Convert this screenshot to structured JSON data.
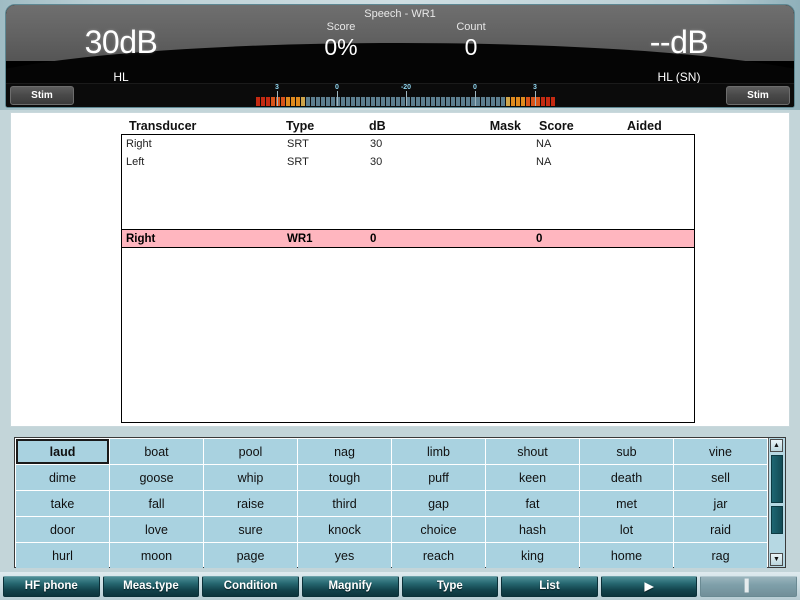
{
  "header": {
    "title": "Speech - WR1",
    "left_readout": {
      "value": "30dB",
      "unit": "HL"
    },
    "right_readout": {
      "value": "--dB",
      "unit": "HL (SN)"
    },
    "score": {
      "label": "Score",
      "value": "0%"
    },
    "count": {
      "label": "Count",
      "value": "0"
    },
    "stim_left": "Stim",
    "stim_right": "Stim",
    "vu_labels": [
      "3",
      "0",
      "-20",
      "0",
      "3"
    ]
  },
  "table": {
    "columns": [
      "Transducer",
      "Type",
      "dB",
      "Mask",
      "Score",
      "Aided"
    ],
    "rows": [
      {
        "transducer": "Right",
        "type": "SRT",
        "db": "30",
        "mask": "",
        "score": "NA",
        "aided": "",
        "active": false
      },
      {
        "transducer": "Left",
        "type": "SRT",
        "db": "30",
        "mask": "",
        "score": "NA",
        "aided": "",
        "active": false
      }
    ],
    "active_row": {
      "transducer": "Right",
      "type": "WR1",
      "db": "0",
      "mask": "",
      "score": "0",
      "aided": ""
    }
  },
  "wordlist": {
    "selected_index": 0,
    "words": [
      "laud",
      "boat",
      "pool",
      "nag",
      "limb",
      "shout",
      "sub",
      "vine",
      "dime",
      "goose",
      "whip",
      "tough",
      "puff",
      "keen",
      "death",
      "sell",
      "take",
      "fall",
      "raise",
      "third",
      "gap",
      "fat",
      "met",
      "jar",
      "door",
      "love",
      "sure",
      "knock",
      "choice",
      "hash",
      "lot",
      "raid",
      "hurl",
      "moon",
      "page",
      "yes",
      "reach",
      "king",
      "home",
      "rag"
    ],
    "scroll_up_icon": "▲",
    "scroll_down_icon": "▼"
  },
  "toolbar": {
    "buttons": [
      {
        "label": "HF phone",
        "disabled": false
      },
      {
        "label": "Meas.type",
        "disabled": false
      },
      {
        "label": "Condition",
        "disabled": false
      },
      {
        "label": "Magnify",
        "disabled": false
      },
      {
        "label": "Type",
        "disabled": false
      },
      {
        "label": "List",
        "disabled": false
      },
      {
        "label": "▶",
        "disabled": false
      },
      {
        "label": "▌",
        "disabled": true
      }
    ]
  },
  "colors": {
    "accent_teal": "#12424b",
    "word_cell": "#a9d2e0",
    "active_row": "#ffb6bf",
    "panel_bg": "#c3d5d9"
  }
}
